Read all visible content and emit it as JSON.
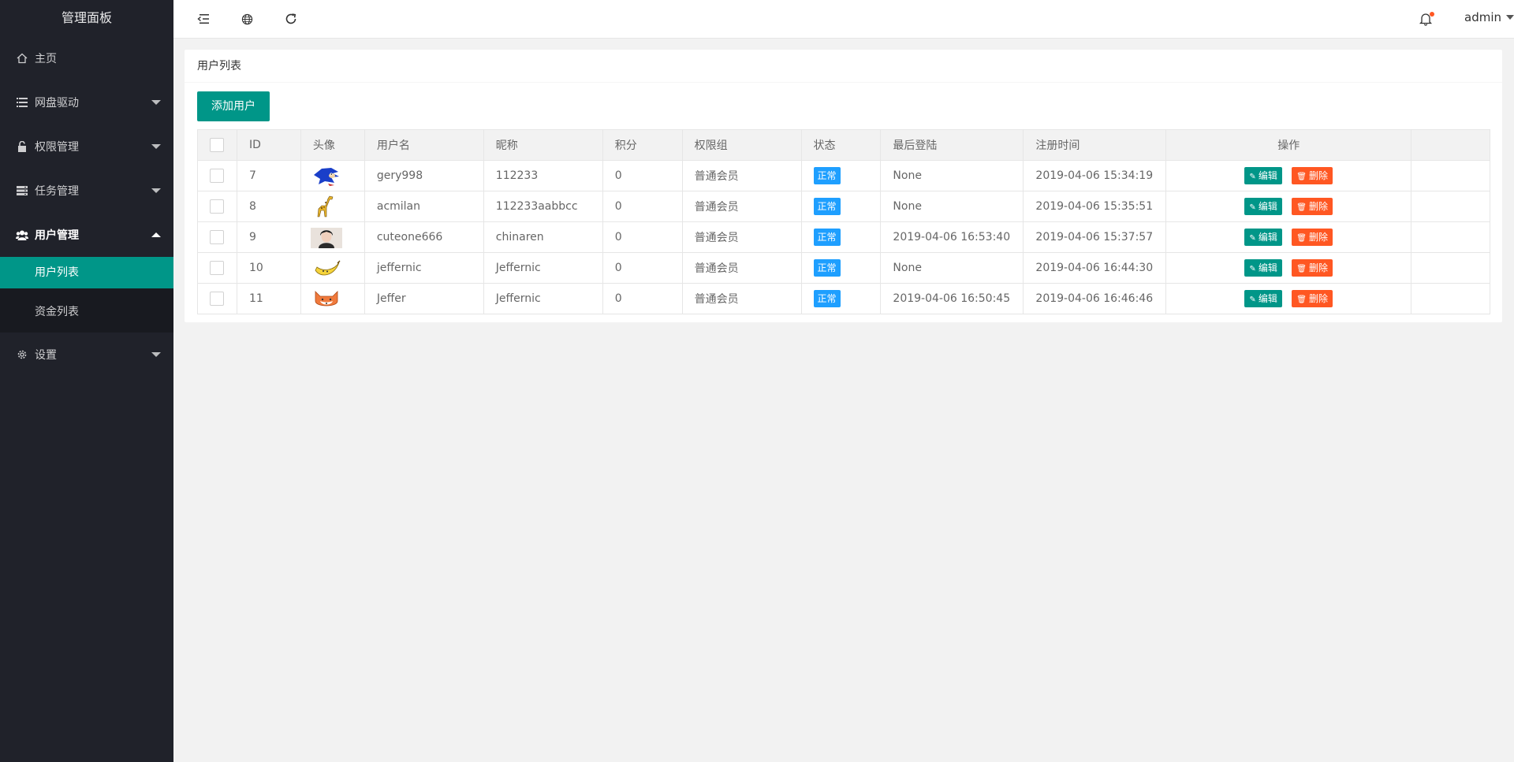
{
  "app": {
    "title": "管理面板"
  },
  "sidebar": {
    "items": [
      {
        "label": "主页",
        "icon": "home-icon"
      },
      {
        "label": "网盘驱动",
        "icon": "list-icon"
      },
      {
        "label": "权限管理",
        "icon": "lock-icon"
      },
      {
        "label": "任务管理",
        "icon": "server-icon"
      },
      {
        "label": "用户管理",
        "icon": "users-icon",
        "expanded": true,
        "children": [
          {
            "label": "用户列表",
            "active": true
          },
          {
            "label": "资金列表"
          }
        ]
      },
      {
        "label": "设置",
        "icon": "gear-icon"
      }
    ]
  },
  "header": {
    "username": "admin",
    "icons": [
      "collapse-menu-icon",
      "globe-icon",
      "refresh-icon",
      "bell-icon"
    ],
    "notification_dot_color": "#ff5722"
  },
  "page": {
    "card_title": "用户列表",
    "add_button": "添加用户"
  },
  "colors": {
    "accent": "#009688",
    "danger": "#ff5722",
    "info": "#1e9fff",
    "sidebar": "#20222a"
  },
  "table": {
    "columns": [
      "ID",
      "头像",
      "用户名",
      "昵称",
      "积分",
      "权限组",
      "状态",
      "最后登陆",
      "注册时间",
      "操作"
    ],
    "rows": [
      {
        "id": "7",
        "avatar": "sonic-avatar",
        "username": "gery998",
        "nickname": "112233",
        "points": "0",
        "group": "普通会员",
        "status": "正常",
        "last_login": "None",
        "registered": "2019-04-06 15:34:19"
      },
      {
        "id": "8",
        "avatar": "giraffe-avatar",
        "username": "acmilan",
        "nickname": "112233aabbcc",
        "points": "0",
        "group": "普通会员",
        "status": "正常",
        "last_login": "None",
        "registered": "2019-04-06 15:35:51"
      },
      {
        "id": "9",
        "avatar": "photo-avatar",
        "username": "cuteone666",
        "nickname": "chinaren",
        "points": "0",
        "group": "普通会员",
        "status": "正常",
        "last_login": "2019-04-06 16:53:40",
        "registered": "2019-04-06 15:37:57"
      },
      {
        "id": "10",
        "avatar": "banana-avatar",
        "username": "jeffernic",
        "nickname": "Jeffernic",
        "points": "0",
        "group": "普通会员",
        "status": "正常",
        "last_login": "None",
        "registered": "2019-04-06 16:44:30"
      },
      {
        "id": "11",
        "avatar": "fox-avatar",
        "username": "Jeffer",
        "nickname": "Jeffernic",
        "points": "0",
        "group": "普通会员",
        "status": "正常",
        "last_login": "2019-04-06 16:50:45",
        "registered": "2019-04-06 16:46:46"
      }
    ],
    "actions": {
      "edit": "编辑",
      "delete": "删除"
    }
  }
}
